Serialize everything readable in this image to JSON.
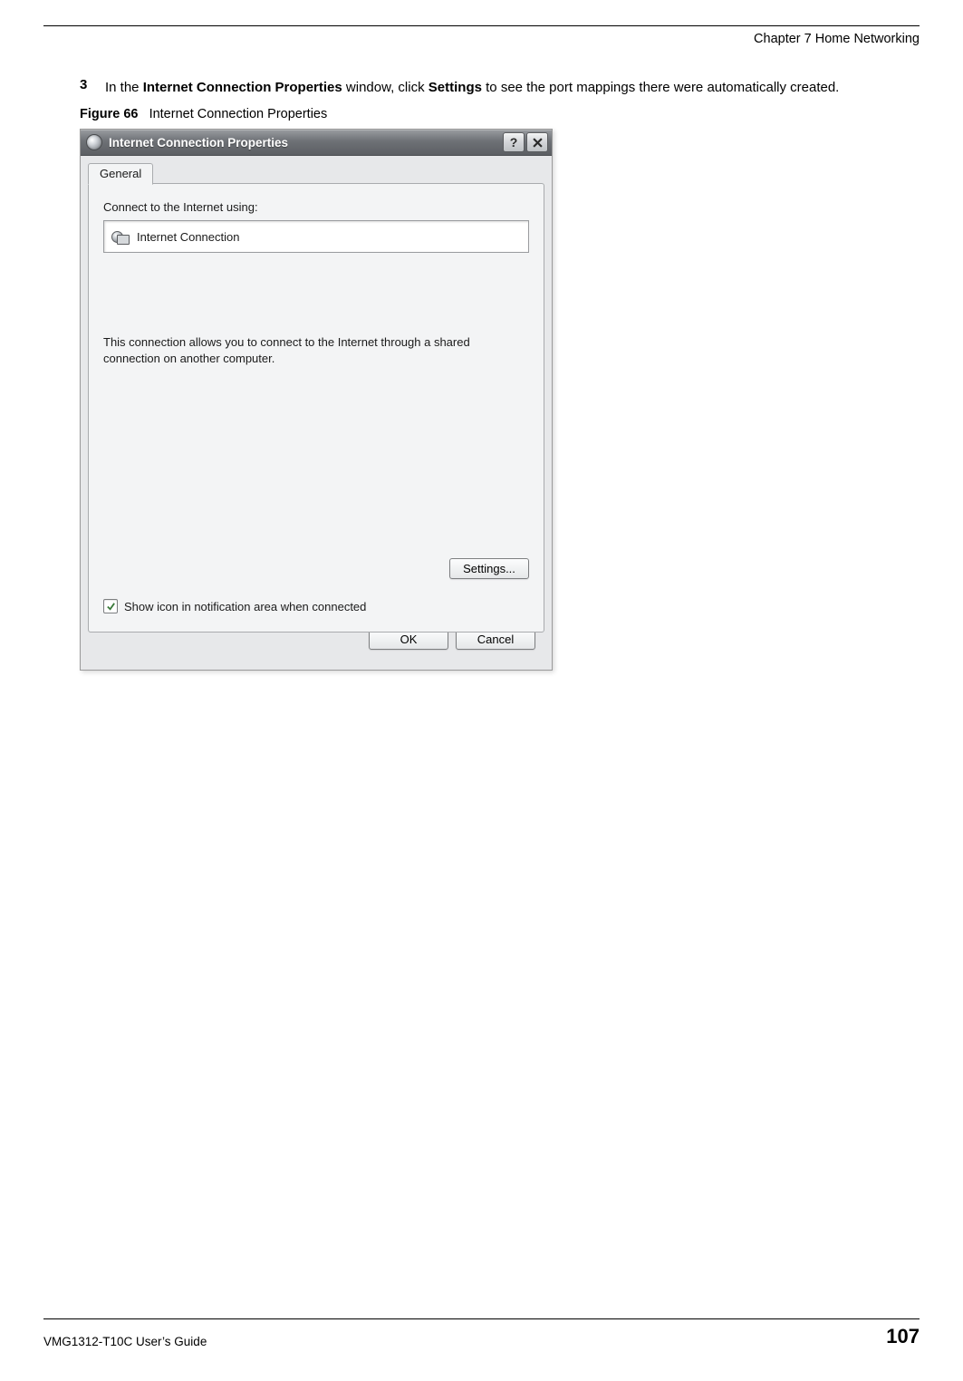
{
  "header": {
    "chapter": "Chapter 7 Home Networking"
  },
  "step": {
    "number": "3",
    "prefix": "In the ",
    "bold1": "Internet Connection Properties",
    "mid": " window, click ",
    "bold2": "Settings",
    "suffix": " to see the port mappings there were automatically created."
  },
  "figure": {
    "label": "Figure 66",
    "caption": "Internet Connection Properties"
  },
  "dialog": {
    "title": "Internet Connection Properties",
    "tab": "General",
    "connect_label": "Connect to the Internet using:",
    "connection_name": "Internet Connection",
    "description": "This connection allows you to connect to the Internet through a shared connection on another computer.",
    "settings_button": "Settings...",
    "checkbox_label": "Show icon in notification area when connected",
    "checkbox_checked": true,
    "ok_button": "OK",
    "cancel_button": "Cancel"
  },
  "footer": {
    "guide": "VMG1312-T10C User’s Guide",
    "page": "107"
  }
}
